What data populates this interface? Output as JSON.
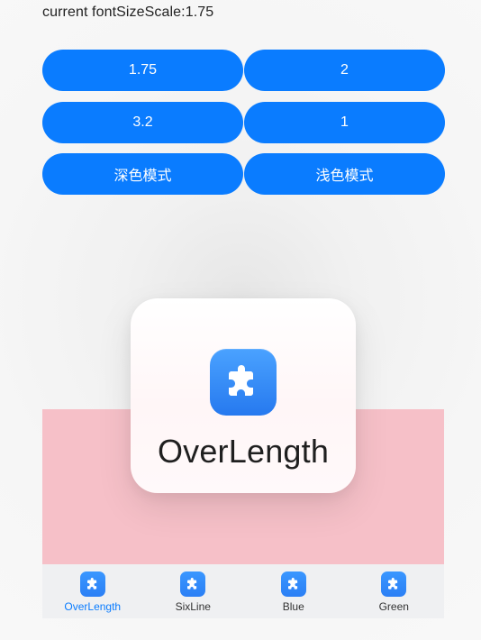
{
  "top_label": "current fontSizeScale:1.75",
  "buttons": {
    "row1_left": "1.75",
    "row1_right": "2",
    "row2_left": "3.2",
    "row2_right": "1",
    "row3_left": "深色模式",
    "row3_right": "浅色模式"
  },
  "popup": {
    "title": "OverLength",
    "icon": "puzzle-icon"
  },
  "tabs": [
    {
      "label": "OverLength",
      "icon": "puzzle-icon",
      "active": true
    },
    {
      "label": "SixLine",
      "icon": "puzzle-icon",
      "active": false
    },
    {
      "label": "Blue",
      "icon": "puzzle-icon",
      "active": false
    },
    {
      "label": "Green",
      "icon": "puzzle-icon",
      "active": false
    }
  ],
  "colors": {
    "accent": "#0a7cff",
    "pink_area": "#f6c0c8",
    "tab_bar": "#eff0f2"
  }
}
